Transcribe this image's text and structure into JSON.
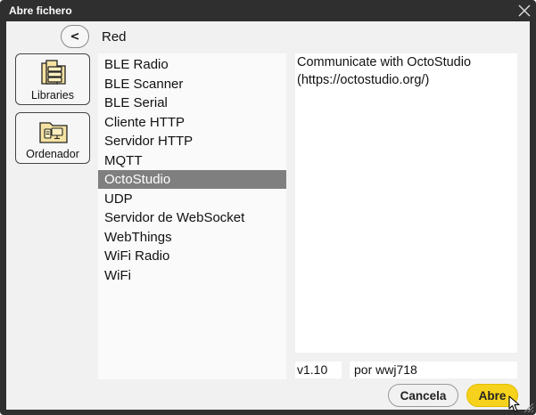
{
  "window": {
    "title": "Abre fichero"
  },
  "nav": {
    "back_label": "<",
    "breadcrumb": "Red"
  },
  "sidebar": {
    "items": [
      {
        "label": "Libraries",
        "icon": "libraries-icon"
      },
      {
        "label": "Ordenador",
        "icon": "computer-folder-icon"
      }
    ]
  },
  "list": {
    "items": [
      "BLE Radio",
      "BLE Scanner",
      "BLE Serial",
      "Cliente HTTP",
      "Servidor HTTP",
      "MQTT",
      "OctoStudio",
      "UDP",
      "Servidor de WebSocket",
      "WebThings",
      "WiFi Radio",
      "WiFi"
    ],
    "selected": "OctoStudio"
  },
  "details": {
    "description_line1": "Communicate with OctoStudio",
    "description_line2": "(https://octostudio.org/)",
    "version": "v1.10",
    "author": "por wwj718"
  },
  "buttons": {
    "cancel": "Cancela",
    "open": "Abre"
  },
  "colors": {
    "titlebar": "#2f2f2f",
    "panel": "#f1f1f1",
    "selected_row": "#7f7f7f",
    "primary_button": "#f7d21c",
    "icon_fill": "#f5e2a2"
  }
}
